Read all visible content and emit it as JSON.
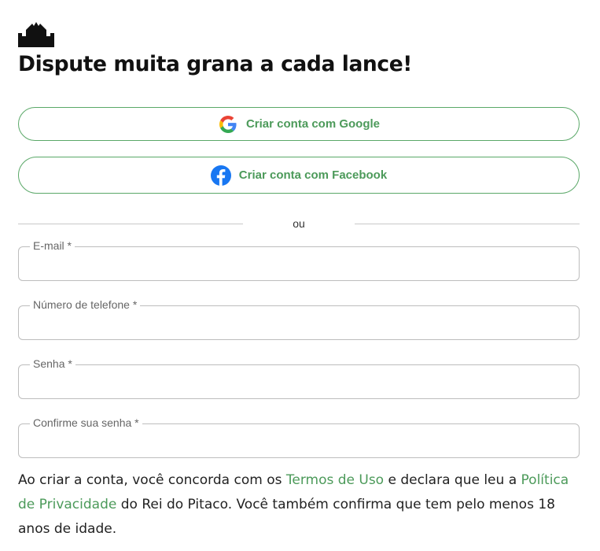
{
  "brand": {
    "logo_icon": "crown-castle-icon"
  },
  "headline": "Dispute muita grana a cada lance!",
  "social_buttons": {
    "google": {
      "label": "Criar conta com Google",
      "icon": "google-icon"
    },
    "facebook": {
      "label": "Criar conta com Facebook",
      "icon": "facebook-icon"
    }
  },
  "divider": {
    "text": "ou"
  },
  "form": {
    "email": {
      "label": "E-mail *",
      "value": ""
    },
    "phone": {
      "label": "Número de telefone *",
      "value": ""
    },
    "password": {
      "label": "Senha *",
      "value": ""
    },
    "confirm_password": {
      "label": "Confirme sua senha *",
      "value": ""
    }
  },
  "terms": {
    "part1": "Ao criar a conta, você concorda com os ",
    "terms_link": "Termos de Uso",
    "part2": " e declara que leu a ",
    "privacy_link": "Política de Privacidade",
    "part3": " do Rei do Pitaco. Você também confirma que tem pelo menos 18 anos de idade."
  },
  "colors": {
    "accent_green": "#4c9a5a",
    "border_green": "#5aa868",
    "text": "#111111",
    "facebook_blue": "#1877f2"
  }
}
